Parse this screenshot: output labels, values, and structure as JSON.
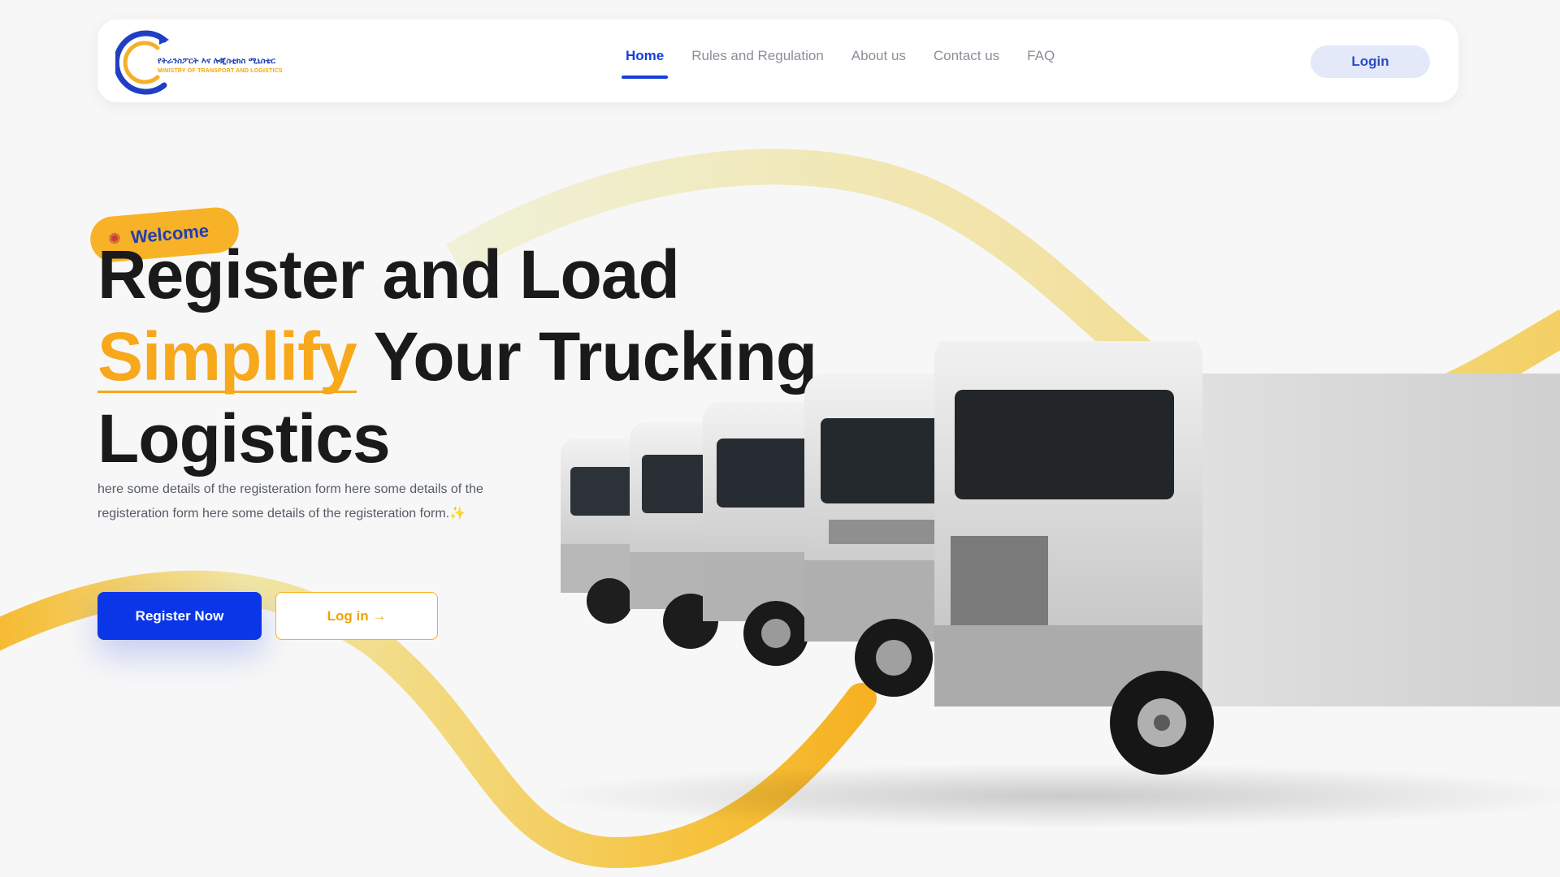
{
  "nav": {
    "logo_amharic": "የትራንስፖርት እና ሎጂስቲክስ ሚኒስቴር",
    "logo_english": "MINISTRY OF TRANSPORT AND LOGISTICS",
    "links": [
      "Home",
      "Rules and Regulation",
      "About us",
      "Contact us",
      "FAQ"
    ],
    "active": "Home",
    "login_label": "Login"
  },
  "hero": {
    "badge_label": "Welcome",
    "badge_icon": "party-popper-icon",
    "headline_line1": "Register and Load",
    "headline_highlight": "Simplify",
    "headline_line2_rest": " Your Trucking",
    "headline_line3": "Logistics",
    "description": "here some details of the registeration form here some details of the registeration form here some details of the registeration form.",
    "description_icon": "sparkles-icon",
    "register_label": "Register Now",
    "login_label": "Log in →",
    "image": "trucks-fleet-image"
  },
  "colors": {
    "primary": "#0a36e8",
    "accent": "#f7a81b",
    "background": "#f7f7f7",
    "heading": "#1a1a1a"
  }
}
